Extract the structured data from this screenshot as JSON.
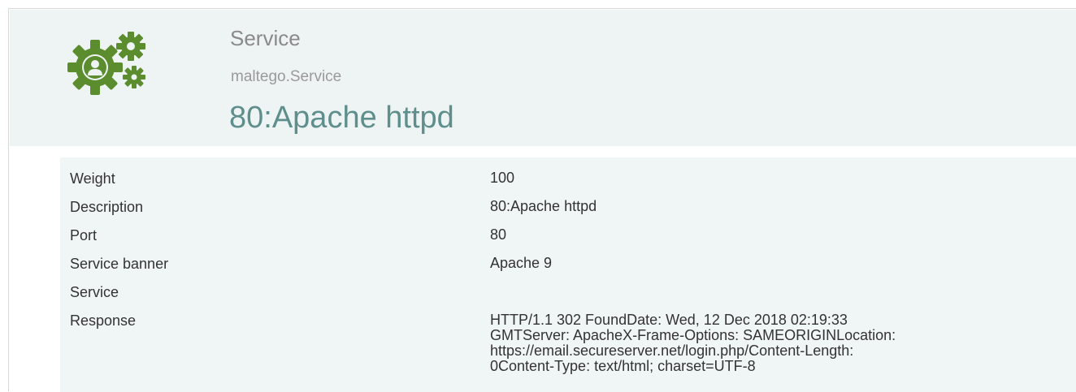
{
  "entity": {
    "type_name": "Service",
    "type_id": "maltego.Service",
    "value": "80:Apache httpd",
    "icon": "service-gears-icon",
    "icon_color": "#5b8c2e"
  },
  "properties": [
    {
      "name": "Weight",
      "value": "100"
    },
    {
      "name": "Description",
      "value": "80:Apache httpd"
    },
    {
      "name": "Port",
      "value": "80"
    },
    {
      "name": "Service banner",
      "value": "Apache 9"
    },
    {
      "name": "Service",
      "value": ""
    },
    {
      "name": "Response",
      "value": "HTTP/1.1 302 FoundDate: Wed, 12 Dec 2018 02:19:33\nGMTServer: ApacheX-Frame-Options: SAMEORIGINLocation:\nhttps://email.secureserver.net/login.php/Content-Length:\n0Content-Type: text/html; charset=UTF-8"
    }
  ],
  "colors": {
    "header_bg": "#eef4f3",
    "props_bg": "#f0f6f5",
    "value_title": "#5e8f8c"
  }
}
